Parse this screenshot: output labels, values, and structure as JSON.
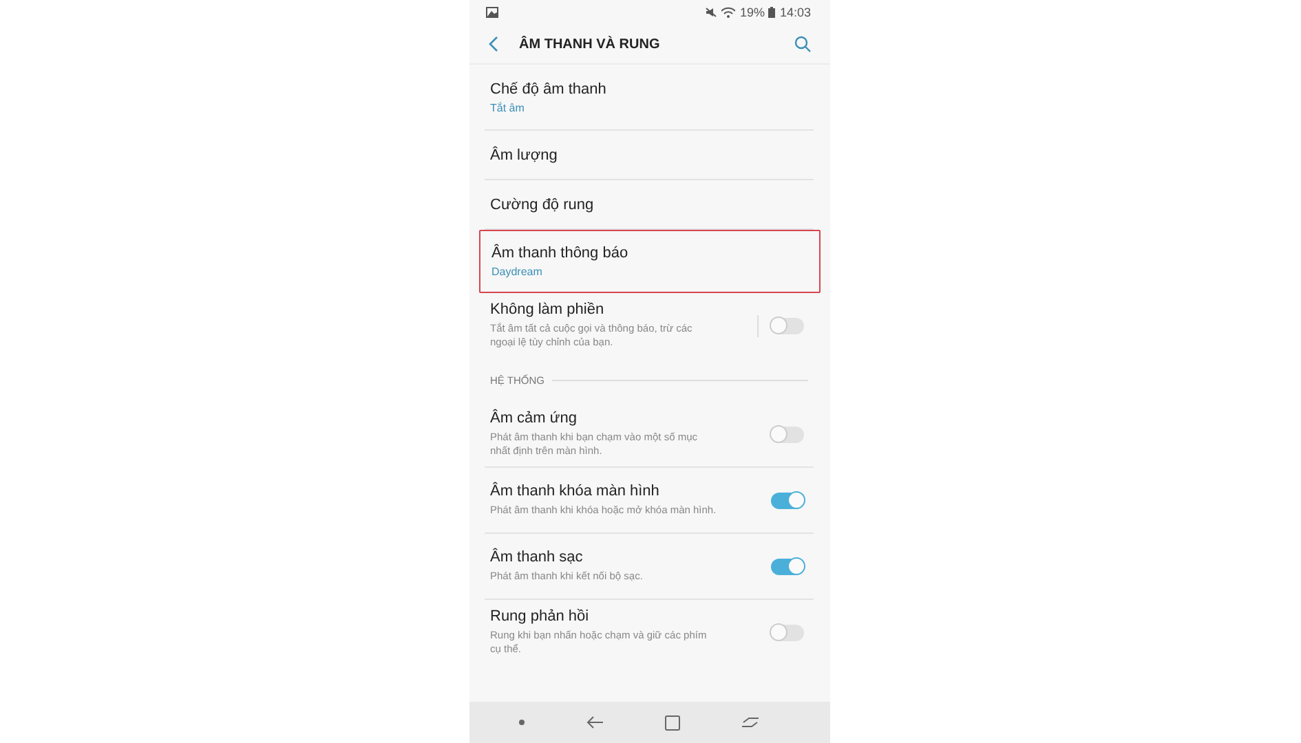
{
  "status_bar": {
    "battery": "19%",
    "time": "14:03"
  },
  "app_bar": {
    "title": "ÂM THANH VÀ RUNG"
  },
  "items": [
    {
      "kind": "link",
      "title": "Chế độ âm thanh",
      "value": "Tắt âm",
      "highlighted": false
    },
    {
      "kind": "link",
      "title": "Âm lượng",
      "highlighted": false
    },
    {
      "kind": "link",
      "title": "Cường độ rung",
      "highlighted": false
    },
    {
      "kind": "link",
      "title": "Âm thanh thông báo",
      "value": "Daydream",
      "highlighted": true
    },
    {
      "kind": "toggle",
      "title": "Không làm phiền",
      "description": "Tắt âm tất cả cuộc gọi và thông báo, trừ các ngoại lệ tùy chỉnh của bạn.",
      "on": false,
      "split": true
    },
    {
      "kind": "header",
      "title": "HỆ THỐNG"
    },
    {
      "kind": "toggle",
      "title": "Âm cảm ứng",
      "description": "Phát âm thanh khi bạn chạm vào một số mục nhất định trên màn hình.",
      "on": false,
      "split": false
    },
    {
      "kind": "toggle",
      "title": "Âm thanh khóa màn hình",
      "description": "Phát âm thanh khi khóa hoặc mở khóa màn hình.",
      "on": true,
      "split": false
    },
    {
      "kind": "toggle",
      "title": "Âm thanh sạc",
      "description": "Phát âm thanh khi kết nối bộ sạc.",
      "on": true,
      "split": false
    },
    {
      "kind": "toggle",
      "title": "Rung phản hồi",
      "description": "Rung khi bạn nhấn hoặc chạm và giữ các phím cụ thể.",
      "on": false,
      "split": false
    }
  ]
}
